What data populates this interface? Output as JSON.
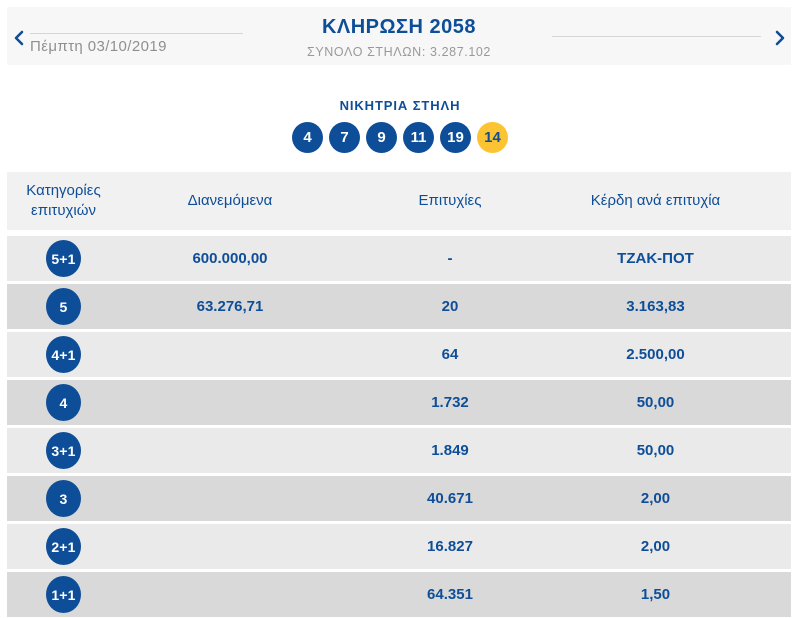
{
  "header": {
    "date": "Πέμπτη 03/10/2019",
    "title": "ΚΛΗΡΩΣΗ 2058",
    "subtitle": "ΣΥΝΟΛΟ ΣΤΗΛΩΝ: 3.287.102",
    "icons": {
      "prev": "chevron-left",
      "next": "chevron-right"
    }
  },
  "winning_column": {
    "title": "ΝΙΚΗΤΡΙΑ ΣΤΗΛΗ",
    "numbers": [
      {
        "value": "4",
        "type": "main"
      },
      {
        "value": "7",
        "type": "main"
      },
      {
        "value": "9",
        "type": "main"
      },
      {
        "value": "11",
        "type": "main"
      },
      {
        "value": "19",
        "type": "main"
      },
      {
        "value": "14",
        "type": "joker"
      }
    ]
  },
  "table": {
    "headers": [
      "Κατηγορίες επιτυχιών",
      "Διανεμόμενα",
      "Επιτυχίες",
      "Κέρδη ανά επιτυχία"
    ],
    "rows": [
      {
        "category": "5+1",
        "distributed": "600.000,00",
        "winners": "-",
        "winnings": "ΤΖΑΚ-ΠΟΤ"
      },
      {
        "category": "5",
        "distributed": "63.276,71",
        "winners": "20",
        "winnings": "3.163,83"
      },
      {
        "category": "4+1",
        "distributed": "",
        "winners": "64",
        "winnings": "2.500,00"
      },
      {
        "category": "4",
        "distributed": "",
        "winners": "1.732",
        "winnings": "50,00"
      },
      {
        "category": "3+1",
        "distributed": "",
        "winners": "1.849",
        "winnings": "50,00"
      },
      {
        "category": "3",
        "distributed": "",
        "winners": "40.671",
        "winnings": "2,00"
      },
      {
        "category": "2+1",
        "distributed": "",
        "winners": "16.827",
        "winnings": "2,00"
      },
      {
        "category": "1+1",
        "distributed": "",
        "winners": "64.351",
        "winnings": "1,50"
      }
    ]
  },
  "colors": {
    "brand_blue": "#0e4e98",
    "joker_yellow": "#fcc433",
    "band_bg": "#f7f7f7",
    "table_header_bg": "#f1f1f1",
    "row_light": "#eaeaea",
    "row_dark": "#d9d9d9",
    "muted_text": "#97999b"
  }
}
